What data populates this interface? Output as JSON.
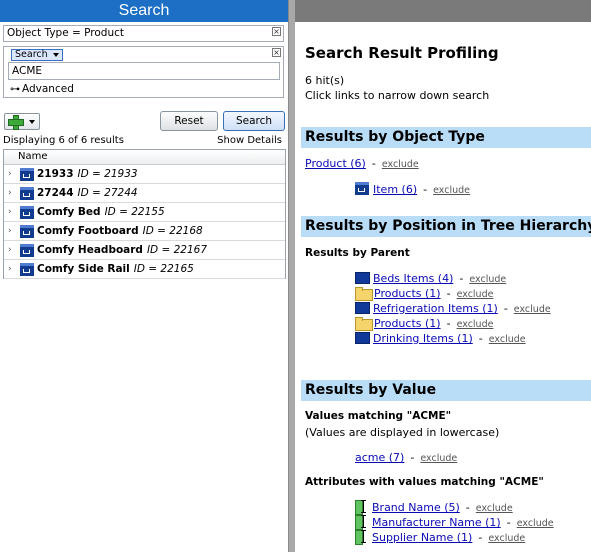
{
  "left": {
    "title": "Search",
    "object_type_filter": "Object Type = Product",
    "search_mode": "Search",
    "search_value": "ACME",
    "advanced_label": "Advanced",
    "reset_label": "Reset",
    "search_label": "Search",
    "displaying_text": "Displaying 6 of 6 results",
    "show_details_label": "Show Details",
    "grid_column": "Name",
    "rows": [
      {
        "name": "21933",
        "id": "ID = 21933"
      },
      {
        "name": "27244",
        "id": "ID = 27244"
      },
      {
        "name": "Comfy Bed",
        "id": "ID = 22155"
      },
      {
        "name": "Comfy Footboard",
        "id": "ID = 22168"
      },
      {
        "name": "Comfy Headboard",
        "id": "ID = 22167"
      },
      {
        "name": "Comfy Side Rail",
        "id": "ID = 22165"
      }
    ]
  },
  "right": {
    "title": "Search Result Profiling",
    "hits": "6 hit(s)",
    "hint": "Click links to narrow down search",
    "exclude_label": "exclude",
    "sep": "-",
    "by_object_type": {
      "heading": "Results by Object Type",
      "product": "Product (6)",
      "item": "Item (6)"
    },
    "by_position": {
      "heading": "Results by Position in Tree Hierarchy",
      "sub": "Results by Parent",
      "parents": [
        {
          "label": "Beds Items (4)",
          "icon": "blue-box-icon"
        },
        {
          "label": "Products (1)",
          "icon": "folder-icon"
        },
        {
          "label": "Refrigeration Items (1)",
          "icon": "blue-box-icon"
        },
        {
          "label": "Products (1)",
          "icon": "folder-icon"
        },
        {
          "label": "Drinking Items (1)",
          "icon": "blue-box-icon"
        }
      ]
    },
    "by_value": {
      "heading": "Results by Value",
      "values_matching": "Values matching \"ACME\"",
      "lowercase_note": "(Values are displayed in lowercase)",
      "value_link": "acme (7)",
      "attrs_matching": "Attributes with values matching \"ACME\"",
      "attributes": [
        "Brand Name (5)",
        "Manufacturer Name (1)",
        "Supplier Name (1)"
      ]
    }
  }
}
